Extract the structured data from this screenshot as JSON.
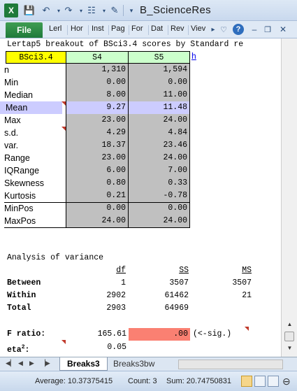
{
  "window": {
    "title": "B_ScienceRes",
    "qat_icons": [
      "excel-app-icon",
      "save-icon",
      "undo-icon",
      "redo-icon",
      "grid-icon",
      "brush-icon",
      "customize-icon"
    ]
  },
  "ribbon": {
    "file_label": "File",
    "tabs": [
      "Lerl",
      "Hor",
      "Inst",
      "Pag",
      "For",
      "Dat",
      "Rev",
      "Viev"
    ]
  },
  "sheet": {
    "title_line": "Lertap5 breakout of BSci3.4 scores by Standard re",
    "header": {
      "label": "BSci3.4",
      "s4": "S4",
      "s5": "S5",
      "extra": "h"
    },
    "stats": [
      {
        "label": "n",
        "s4": "1,310",
        "s5": "1,594"
      },
      {
        "label": "Min",
        "s4": "0.00",
        "s5": "0.00"
      },
      {
        "label": "Median",
        "s4": "8.00",
        "s5": "11.00"
      },
      {
        "label": "Mean",
        "s4": "9.27",
        "s5": "11.48"
      },
      {
        "label": "Max",
        "s4": "23.00",
        "s5": "24.00"
      },
      {
        "label": "s.d.",
        "s4": "4.29",
        "s5": "4.84"
      },
      {
        "label": "var.",
        "s4": "18.37",
        "s5": "23.46"
      },
      {
        "label": "Range",
        "s4": "23.00",
        "s5": "24.00"
      },
      {
        "label": "IQRange",
        "s4": "6.00",
        "s5": "7.00"
      },
      {
        "label": "Skewness",
        "s4": "0.80",
        "s5": "0.33"
      },
      {
        "label": "Kurtosis",
        "s4": "0.21",
        "s5": "-0.78"
      },
      {
        "label": "MinPos",
        "s4": "0.00",
        "s5": "0.00"
      },
      {
        "label": "MaxPos",
        "s4": "24.00",
        "s5": "24.00"
      }
    ],
    "anova": {
      "title": "Analysis of variance",
      "headers": {
        "df": "df",
        "ss": "SS",
        "ms": "MS"
      },
      "rows": [
        {
          "label": "Between",
          "df": "1",
          "ss": "3507",
          "ms": "3507"
        },
        {
          "label": "Within",
          "df": "2902",
          "ss": "61462",
          "ms": "21"
        },
        {
          "label": "Total",
          "df": "2903",
          "ss": "64969",
          "ms": ""
        }
      ],
      "f_label": "F ratio:",
      "f_value": "165.61",
      "sig_value": ".00",
      "sig_note": "(<-sig.)",
      "eta_label": "eta",
      "eta_sup": "2",
      "eta_suffix": ":",
      "eta_value": "0.05"
    }
  },
  "tabs": {
    "active": "Breaks3",
    "other": "Breaks3bw"
  },
  "status": {
    "average": "Average: 10.37375415",
    "count": "Count: 3",
    "sum": "Sum: 20.74750831"
  },
  "colors": {
    "header_label": "#ffff00",
    "header_col": "#ccffcc",
    "highlight": "#ccccff",
    "gray_cells": "#c0c0c0",
    "sig_cell": "#fa8072",
    "file_tab": "#1f7a3a"
  }
}
